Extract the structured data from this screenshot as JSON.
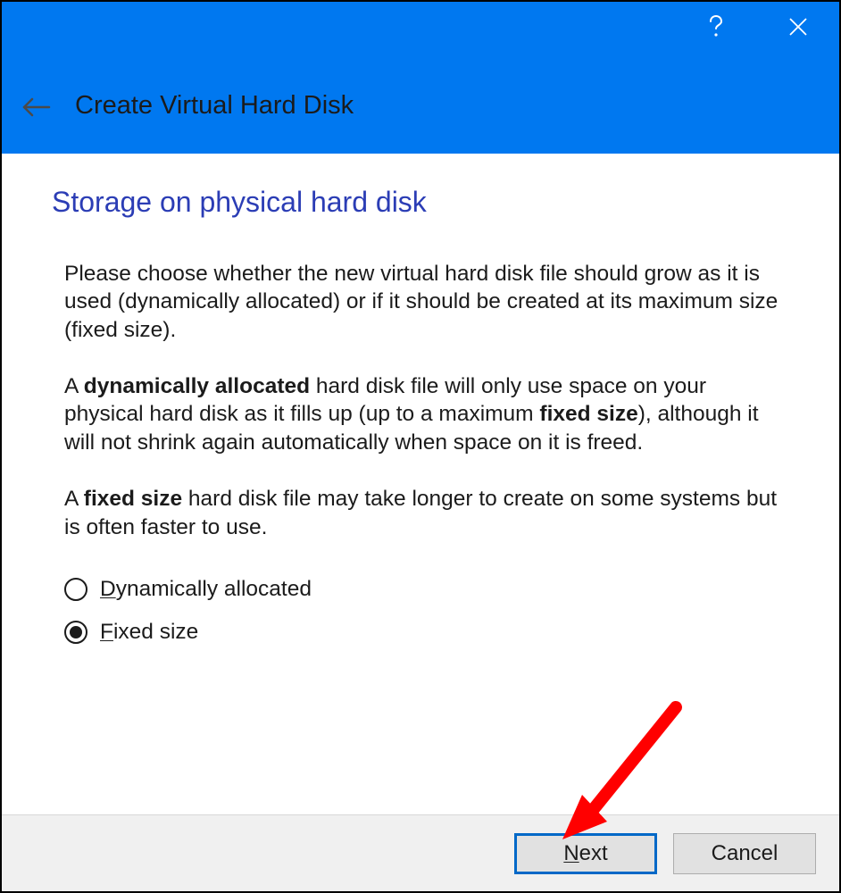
{
  "window": {
    "title": "Create Virtual Hard Disk"
  },
  "page": {
    "heading": "Storage on physical hard disk",
    "paragraph1": "Please choose whether the new virtual hard disk file should grow as it is used (dynamically allocated) or if it should be created at its maximum size (fixed size).",
    "paragraph2_prefix": "A ",
    "paragraph2_bold1": "dynamically allocated",
    "paragraph2_mid": " hard disk file will only use space on your physical hard disk as it fills up (up to a maximum ",
    "paragraph2_bold2": "fixed size",
    "paragraph2_suffix": "), although it will not shrink again automatically when space on it is freed.",
    "paragraph3_prefix": "A ",
    "paragraph3_bold": "fixed size",
    "paragraph3_suffix": " hard disk file may take longer to create on some systems but is often faster to use."
  },
  "radios": {
    "option1_first": "D",
    "option1_rest": "ynamically allocated",
    "option1_selected": false,
    "option2_first": "F",
    "option2_rest": "ixed size",
    "option2_selected": true
  },
  "buttons": {
    "next_first": "N",
    "next_rest": "ext",
    "cancel": "Cancel"
  }
}
